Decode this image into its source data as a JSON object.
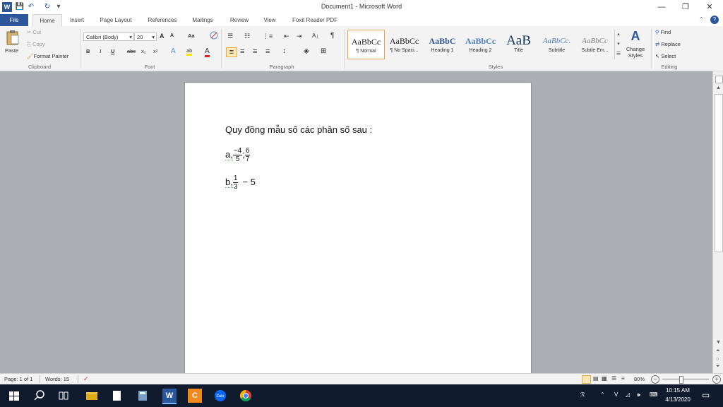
{
  "window": {
    "title": "Document1 - Microsoft Word",
    "min_glyph": "—",
    "restore_glyph": "❐",
    "close_glyph": "✕",
    "help_glyph": "?"
  },
  "quick_access": [
    "W",
    "💾",
    "↶",
    "↻",
    "▾"
  ],
  "tabs": [
    "File",
    "Home",
    "Insert",
    "Page Layout",
    "References",
    "Mailings",
    "Review",
    "View",
    "Foxit Reader PDF"
  ],
  "clipboard": {
    "paste": "Paste",
    "cut": "Cut",
    "copy": "Copy",
    "format_painter": "Format Painter",
    "label": "Clipboard"
  },
  "font": {
    "family": "Calibri (Body)",
    "size": "20",
    "grow": "A",
    "shrink": "A",
    "case": "Aa",
    "bold": "B",
    "italic": "I",
    "underline": "U",
    "strike": "abc",
    "subscript": "x₂",
    "superscript": "x²",
    "effects": "A",
    "highlight": "ab",
    "color": "A",
    "label": "Font"
  },
  "paragraph": {
    "bullets": "☰",
    "numbering": "☷",
    "multilevel": "⋮≡",
    "decrease_indent": "⇤",
    "increase_indent": "⇥",
    "sort": "A↓",
    "pilcrow": "¶",
    "align_left": "≡",
    "align_center": "≡",
    "align_right": "≡",
    "justify": "≡",
    "line_spacing": "↕",
    "shading": "◈",
    "borders": "⊞",
    "label": "Paragraph"
  },
  "styles": {
    "items": [
      {
        "preview": "AaBbCc",
        "name": "¶ Normal"
      },
      {
        "preview": "AaBbCc",
        "name": "¶ No Spaci..."
      },
      {
        "preview": "AaBbC",
        "name": "Heading 1"
      },
      {
        "preview": "AaBbCc",
        "name": "Heading 2"
      },
      {
        "preview": "AaB",
        "name": "Title"
      },
      {
        "preview": "AaBbCc.",
        "name": "Subtitle"
      },
      {
        "preview": "AaBbCc",
        "name": "Subtle Em..."
      }
    ],
    "change_styles": "Change Styles",
    "label": "Styles"
  },
  "editing": {
    "find": "Find",
    "replace": "Replace",
    "select": "Select",
    "label": "Editing"
  },
  "document": {
    "line1": "Quy đồng mẫu số các phân số sau :",
    "a_prefix": "a,",
    "a_f1_num": "−4",
    "a_f1_den": "5",
    "a_sep": ";",
    "a_f2_num": "6",
    "a_f2_den": "7",
    "b_prefix": "b,",
    "b_f1_num": "1",
    "b_f1_den": "3",
    "b_rest": "− 5"
  },
  "status": {
    "page": "Page: 1 of 1",
    "words": "Words: 15",
    "zoom": "80%",
    "zoom_level": 0.8
  },
  "taskbar": {
    "time": "10:15 AM",
    "date": "4/13/2020",
    "apps": [
      "Start",
      "Search",
      "Task View",
      "File Explorer",
      "Notepad",
      "Calculator",
      "Word",
      "App",
      "Zalo",
      "Chrome"
    ]
  }
}
